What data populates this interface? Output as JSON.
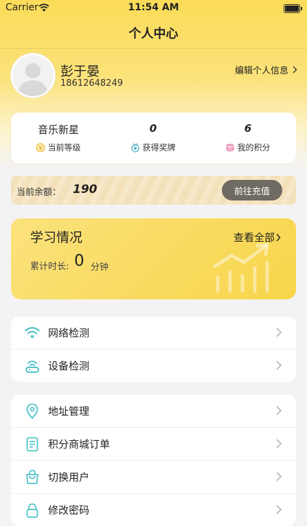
{
  "status_bar": {
    "carrier": "Carrier",
    "time": "11:54 AM"
  },
  "header": {
    "title": "个人中心"
  },
  "profile": {
    "name": "彭于晏",
    "phone": "18612648249",
    "edit_label": "编辑个人信息"
  },
  "stats": [
    {
      "value": "音乐新星",
      "label": "当前等级",
      "icon": "level-icon"
    },
    {
      "value": "0",
      "label": "获得奖牌",
      "icon": "medal-icon"
    },
    {
      "value": "6",
      "label": "我的积分",
      "icon": "points-icon"
    }
  ],
  "balance": {
    "label": "当前余额：",
    "value": "190",
    "button": "前往充值"
  },
  "study": {
    "title": "学习情况",
    "view_all": "查看全部",
    "time_label": "累计时长:",
    "time_value": "0",
    "time_unit": "分钟"
  },
  "menu_group1": [
    {
      "label": "网络检测",
      "icon": "wifi-icon"
    },
    {
      "label": "设备检测",
      "icon": "device-icon"
    }
  ],
  "menu_group2": [
    {
      "label": "地址管理",
      "icon": "location-icon"
    },
    {
      "label": "积分商城订单",
      "icon": "order-icon"
    },
    {
      "label": "切换用户",
      "icon": "bag-icon"
    },
    {
      "label": "修改密码",
      "icon": "lock-icon"
    }
  ],
  "colors": {
    "accent": "#fbdc58",
    "icon_teal": "#4fc3c8",
    "button_dark": "#6f6a62"
  }
}
